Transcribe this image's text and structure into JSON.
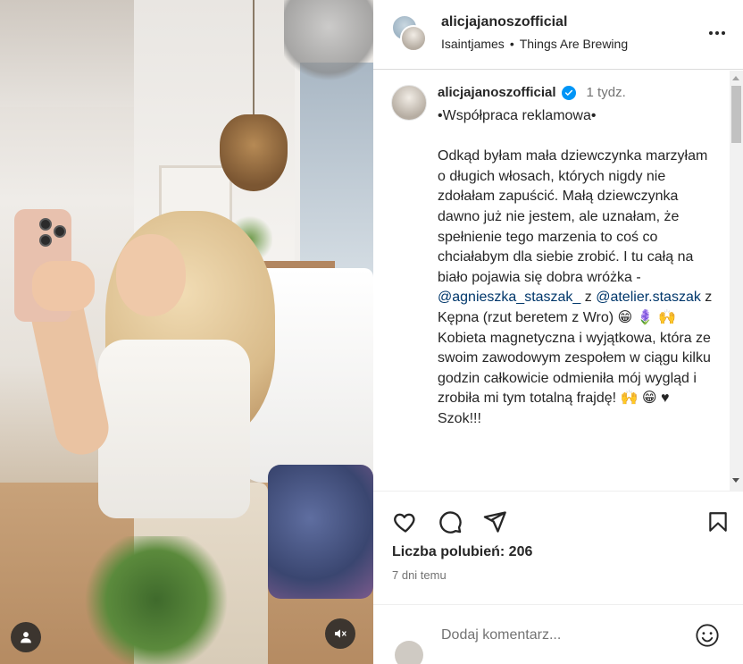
{
  "header": {
    "username": "alicjajanoszofficial",
    "audio_artist": "Isaintjames",
    "audio_separator": "•",
    "audio_title": "Things Are Brewing"
  },
  "caption": {
    "username": "alicjajanoszofficial",
    "time": "1 tydz.",
    "text_intro": "•Współpraca reklamowa•\n\nOdkąd byłam mała dziewczynka marzyłam o długich włosach, których nigdy nie zdołałam zapuścić. Małą dziewczynka dawno już nie jestem, ale uznałam, że spełnienie tego marzenia to coś co chciałabym dla siebie zrobić. I tu całą na biało pojawia się dobra wróżka - ",
    "mention_1": "@agnieszka_staszak_",
    "between_mentions": " z ",
    "mention_2": "@atelier.staszak",
    "text_after_mention": " z Kępna (rzut beretem z Wro) 😁 🪻 🙌\nKobieta magnetyczna i wyjątkowa, która ze swoim zawodowym zespołem w ciągu kilku godzin całkowicie odmieniła mój wygląd i zrobiła mi tym totalną frajdę! 🙌 😁 ♥ Szok!!!"
  },
  "stats": {
    "likes_text": "Liczba polubień: 206",
    "date_text": "7 dni temu"
  },
  "comment": {
    "placeholder": "Dodaj komentarz..."
  },
  "icons": {
    "like": "heart-icon",
    "comment": "comment-bubble-icon",
    "share": "paper-plane-icon",
    "save": "bookmark-icon",
    "more": "more-dots-icon",
    "tag": "user-tag-icon",
    "mute": "speaker-muted-icon",
    "emoji": "emoji-icon",
    "verified": "verified-badge-icon"
  },
  "colors": {
    "verified": "#0095f6",
    "mention": "#00376b",
    "text": "#262626",
    "secondary": "#737373"
  }
}
